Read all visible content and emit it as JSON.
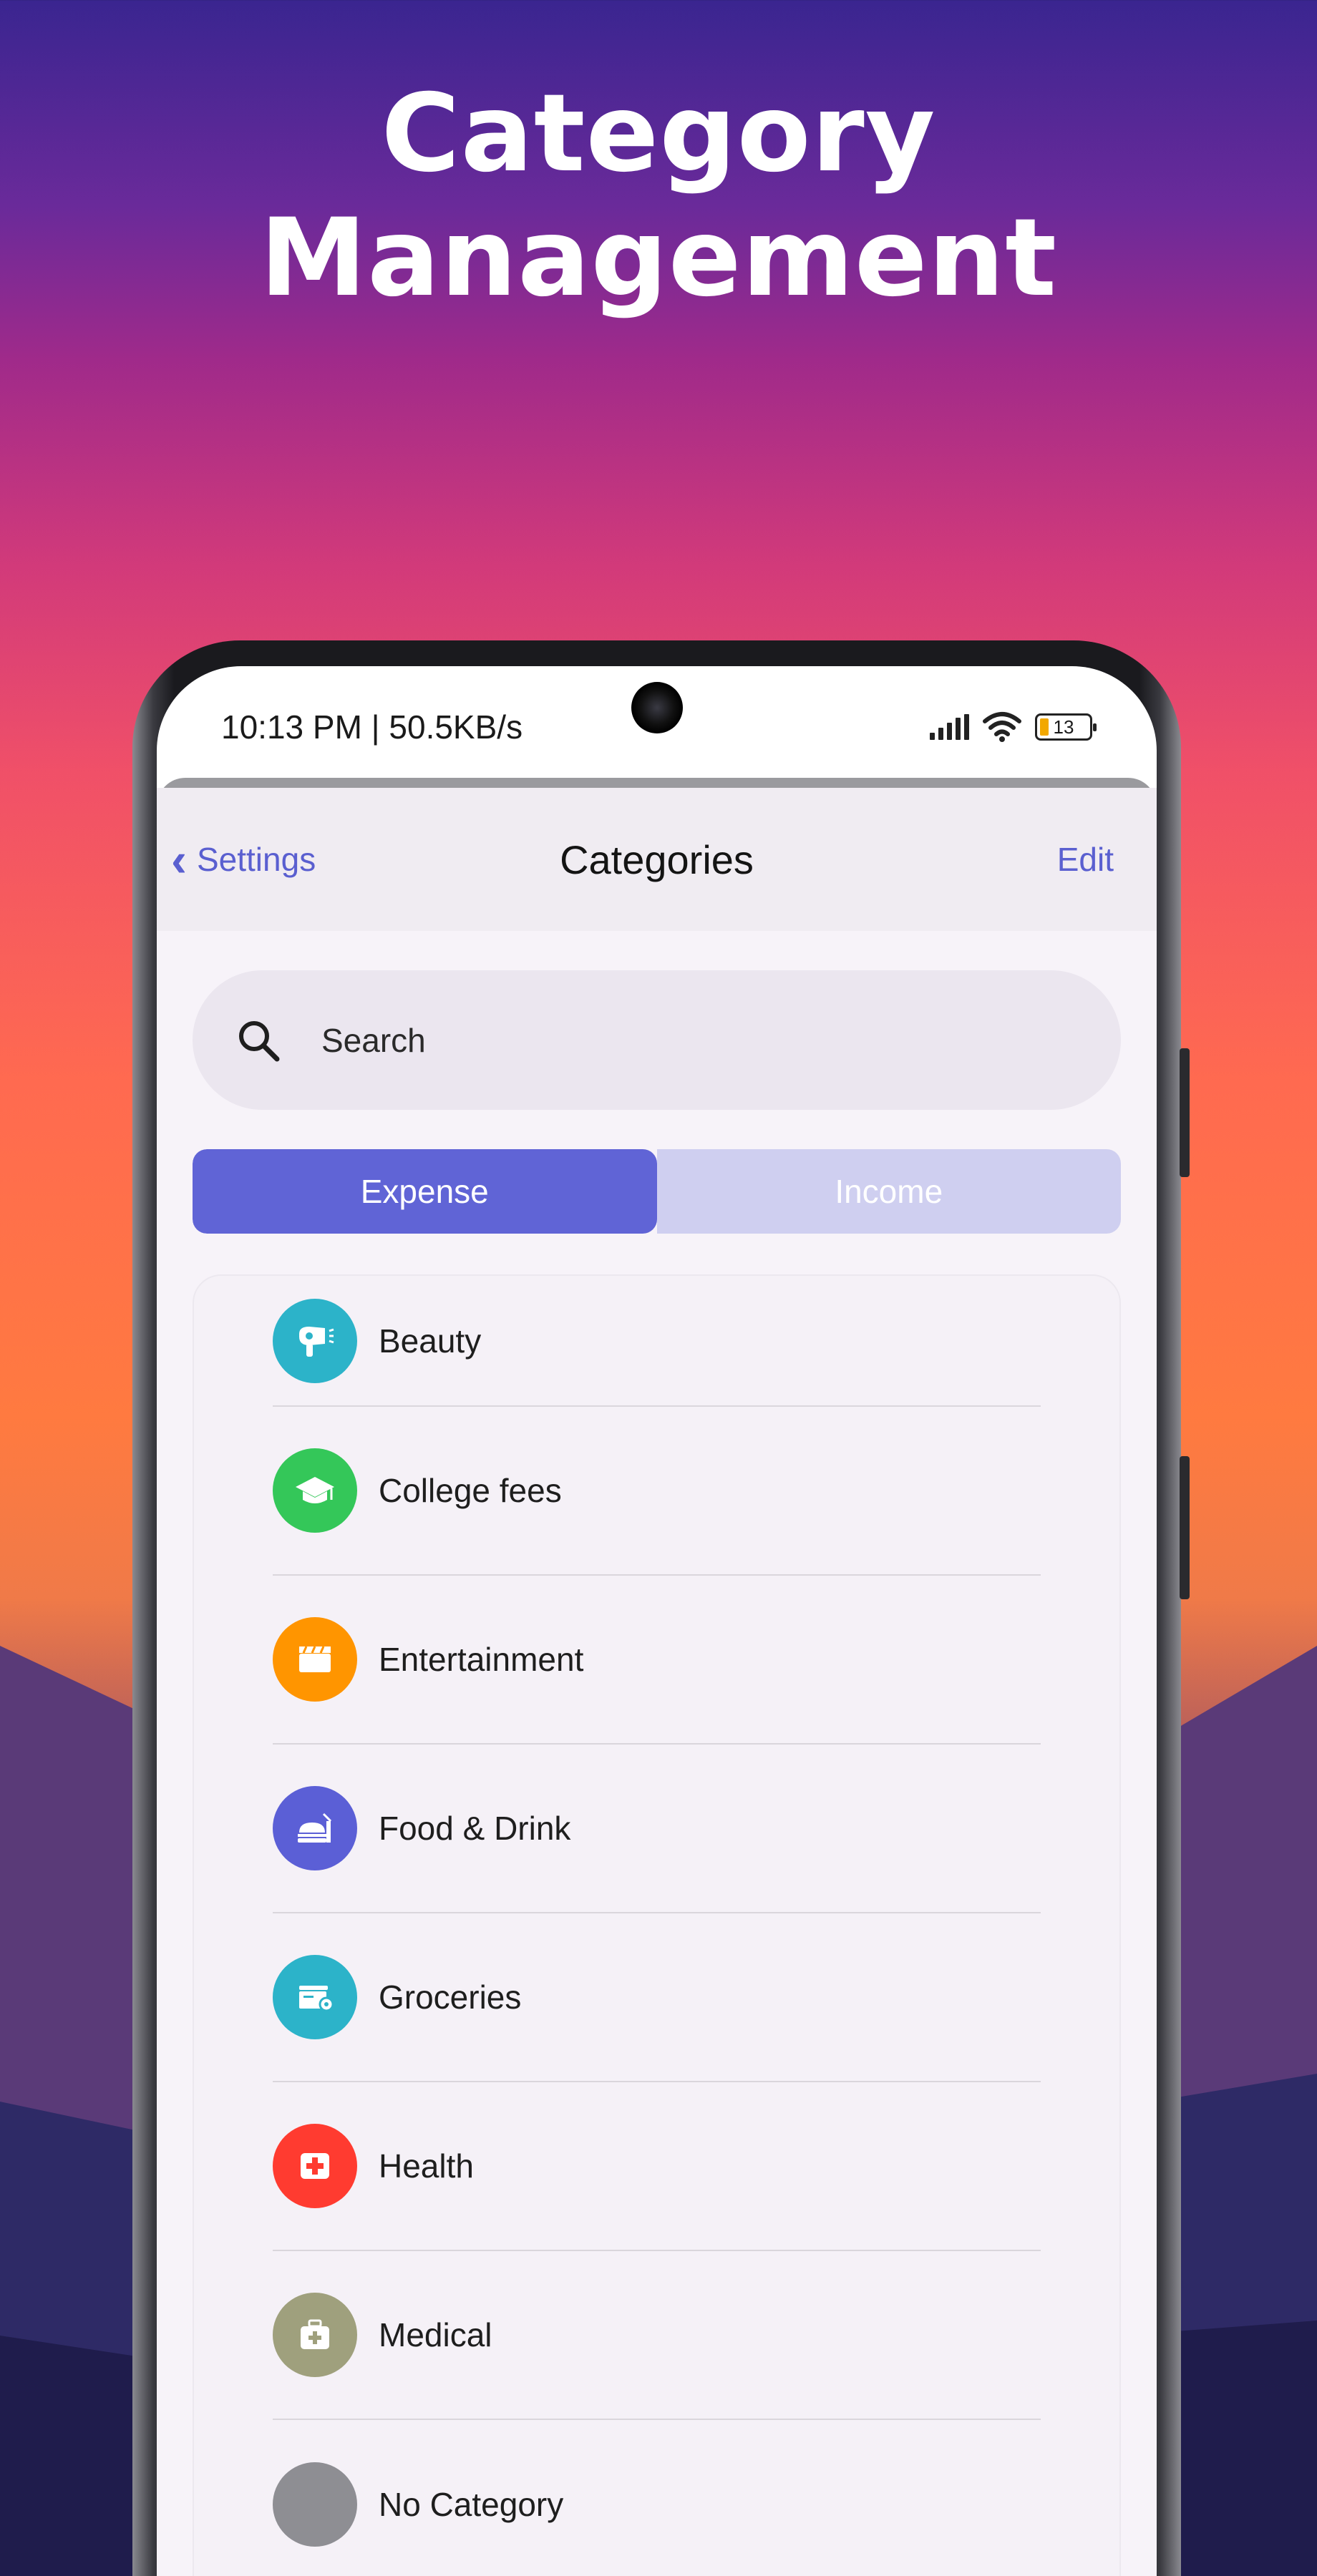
{
  "headline": "Category Management",
  "status_bar": {
    "time_speed": "10:13 PM | 50.5KB/s",
    "battery": "13"
  },
  "nav": {
    "back_label": "Settings",
    "title": "Categories",
    "edit_label": "Edit"
  },
  "search": {
    "placeholder": "Search"
  },
  "tabs": [
    {
      "label": "Expense",
      "active": true
    },
    {
      "label": "Income",
      "active": false
    }
  ],
  "categories": [
    {
      "label": "Beauty",
      "icon": "hair-dryer-icon",
      "color": "#2cb3c9"
    },
    {
      "label": "College fees",
      "icon": "graduation-cap-icon",
      "color": "#34c759"
    },
    {
      "label": "Entertainment",
      "icon": "clapperboard-icon",
      "color": "#ff9500"
    },
    {
      "label": "Food & Drink",
      "icon": "food-drink-icon",
      "color": "#5b5fd6"
    },
    {
      "label": "Groceries",
      "icon": "store-icon",
      "color": "#2cb3c9"
    },
    {
      "label": "Health",
      "icon": "first-aid-icon",
      "color": "#ff3b30"
    },
    {
      "label": "Medical",
      "icon": "medical-bag-icon",
      "color": "#9fa07d"
    },
    {
      "label": "No Category",
      "icon": "blank-circle-icon",
      "color": "#8e8e93"
    }
  ],
  "colors": {
    "accent": "#5a5fd0",
    "tab_active": "#6064d6",
    "tab_inactive": "#cfcff0"
  }
}
